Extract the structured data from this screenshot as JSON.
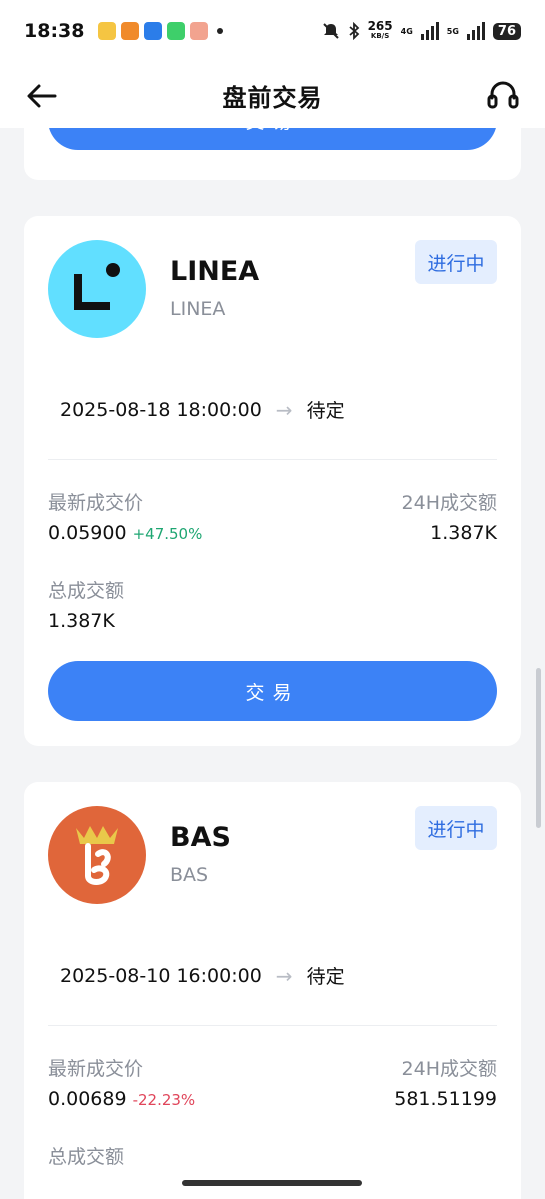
{
  "status_bar": {
    "time": "18:38",
    "net_speed": "265",
    "net_speed_unit": "KB/S",
    "signal1_label": "4G",
    "signal2_label": "5G",
    "battery": "76"
  },
  "header": {
    "title": "盘前交易"
  },
  "top_card": {
    "trade_label": "交易"
  },
  "cards": [
    {
      "name": "LINEA",
      "subname": "LINEA",
      "status": "进行中",
      "start_time": "2025-08-18 18:00:00",
      "end_time": "待定",
      "last_price_label": "最新成交价",
      "last_price": "0.05900",
      "change": "+47.50%",
      "volume_24h_label": "24H成交额",
      "volume_24h": "1.387K",
      "total_volume_label": "总成交额",
      "total_volume": "1.387K",
      "trade_label": "交易"
    },
    {
      "name": "BAS",
      "subname": "BAS",
      "status": "进行中",
      "start_time": "2025-08-10 16:00:00",
      "end_time": "待定",
      "last_price_label": "最新成交价",
      "last_price": "0.00689",
      "change": "-22.23%",
      "volume_24h_label": "24H成交额",
      "volume_24h": "581.51199",
      "total_volume_label": "总成交额"
    }
  ],
  "colors": {
    "accent": "#3c82f6",
    "up": "#1ea672",
    "down": "#e0455a",
    "linea_logo_bg": "#61dfff",
    "bas_logo_bg": "#e0663a"
  }
}
